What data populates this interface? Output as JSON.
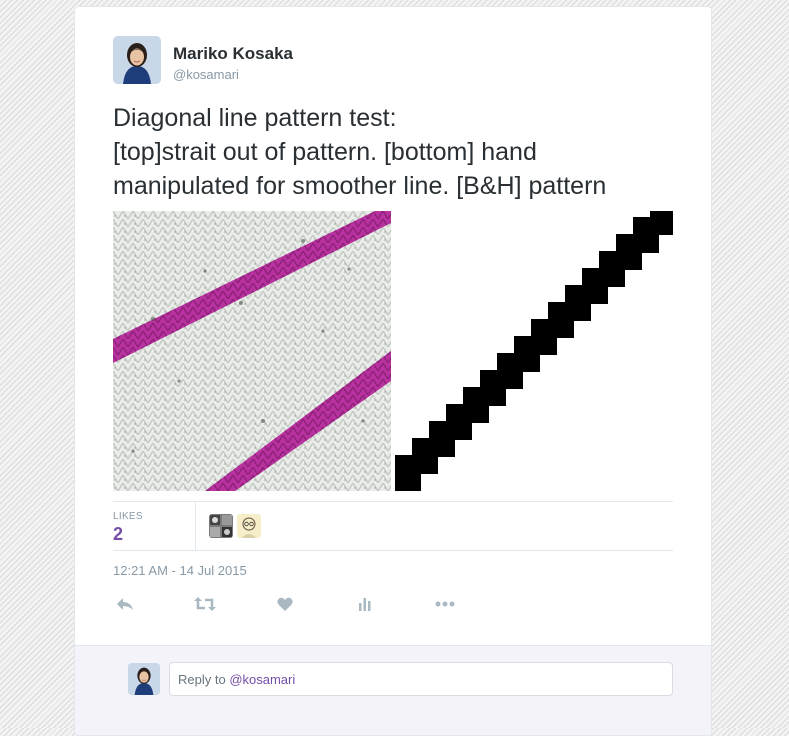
{
  "author": {
    "name": "Mariko Kosaka",
    "handle": "@kosamari"
  },
  "tweet": {
    "lines": [
      "Diagonal line pattern test:",
      "[top]strait out of pattern.  [bottom] hand",
      "manipulated for smoother line. [B&H] pattern"
    ]
  },
  "stats": {
    "likes_label": "LIKES",
    "likes_count": "2"
  },
  "timestamp": "12:21 AM - 14 Jul 2015",
  "actions": [
    "reply-icon",
    "retweet-icon",
    "heart-icon",
    "analytics-icon",
    "more-icon"
  ],
  "reply": {
    "prefix": "Reply to ",
    "mention": "@kosamari"
  },
  "colors": {
    "accent": "#744ea6",
    "yarn_magenta": "#b8329f",
    "muted": "#8899a6",
    "text": "#292f33"
  }
}
